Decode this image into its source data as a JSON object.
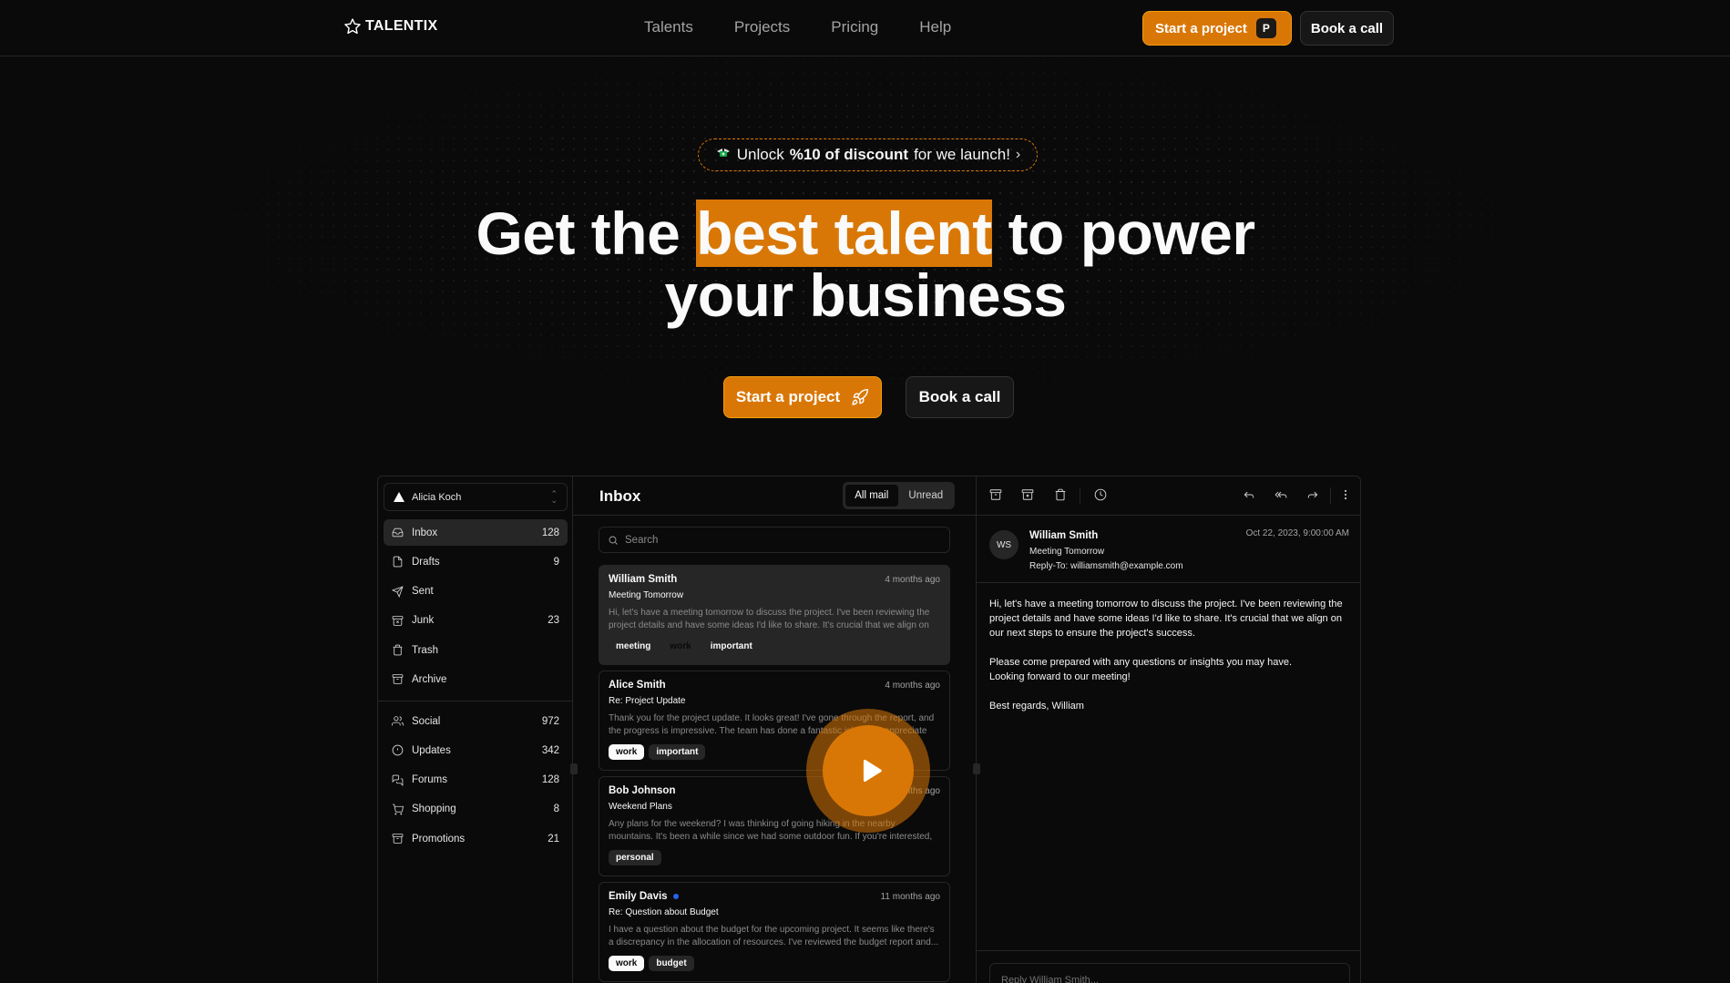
{
  "brand": {
    "name": "TALENTIX"
  },
  "nav": [
    "Talents",
    "Projects",
    "Pricing",
    "Help"
  ],
  "header": {
    "start_label": "Start a project",
    "start_kbd": "P",
    "book_label": "Book a call"
  },
  "hero": {
    "promo_prefix": "Unlock",
    "promo_bold": "%10 of discount",
    "promo_suffix": "for we launch!",
    "title_before": "Get the",
    "title_highlight": "best talent",
    "title_after": "to power",
    "title_line2": "your business",
    "cta_primary": "Start a project",
    "cta_secondary": "Book a call"
  },
  "colors": {
    "accent": "#d97706",
    "background": "#0a0a0a",
    "unread_dot": "#2563eb"
  },
  "mail_app": {
    "account": "Alicia Koch",
    "folders": [
      {
        "label": "Inbox",
        "count": "128",
        "icon": "inbox-icon"
      },
      {
        "label": "Drafts",
        "count": "9",
        "icon": "file-icon"
      },
      {
        "label": "Sent",
        "count": "",
        "icon": "send-icon"
      },
      {
        "label": "Junk",
        "count": "23",
        "icon": "archive-x-icon"
      },
      {
        "label": "Trash",
        "count": "",
        "icon": "trash-icon"
      },
      {
        "label": "Archive",
        "count": "",
        "icon": "archive-icon"
      }
    ],
    "categories": [
      {
        "label": "Social",
        "count": "972",
        "icon": "users-icon"
      },
      {
        "label": "Updates",
        "count": "342",
        "icon": "alert-circle-icon"
      },
      {
        "label": "Forums",
        "count": "128",
        "icon": "message-square-icon"
      },
      {
        "label": "Shopping",
        "count": "8",
        "icon": "shopping-cart-icon"
      },
      {
        "label": "Promotions",
        "count": "21",
        "icon": "archive-icon"
      }
    ],
    "list_title": "Inbox",
    "filter_all": "All mail",
    "filter_unread": "Unread",
    "search_placeholder": "Search",
    "mails": [
      {
        "from": "William Smith",
        "when": "4 months ago",
        "subject": "Meeting Tomorrow",
        "preview": "Hi, let's have a meeting tomorrow to discuss the project. I've been reviewing the project details and have some ideas I'd like to share. It's crucial that we align on our next step...",
        "tags": [
          "meeting",
          "work",
          "important"
        ]
      },
      {
        "from": "Alice Smith",
        "when": "4 months ago",
        "subject": "Re: Project Update",
        "preview": "Thank you for the project update. It looks great! I've gone through the report, and the progress is impressive. The team has done a fantastic job, and I appreciate the hard...",
        "tags": [
          "work",
          "important"
        ]
      },
      {
        "from": "Bob Johnson",
        "when": "5 months ago",
        "subject": "Weekend Plans",
        "preview": "Any plans for the weekend? I was thinking of going hiking in the nearby mountains. It's been a while since we had some outdoor fun. If you're interested, let me know, and we...",
        "tags": [
          "personal"
        ]
      },
      {
        "from": "Emily Davis",
        "when": "11 months ago",
        "subject": "Re: Question about Budget",
        "preview": "I have a question about the budget for the upcoming project. It seems like there's a discrepancy in the allocation of resources. I've reviewed the budget report and...",
        "tags": [
          "work",
          "budget"
        ]
      }
    ],
    "reader": {
      "initials": "WS",
      "from": "William Smith",
      "subject": "Meeting Tomorrow",
      "reply_to": "Reply-To: williamsmith@example.com",
      "date": "Oct 22, 2023, 9:00:00 AM",
      "body": [
        "Hi, let's have a meeting tomorrow to discuss the project. I've been reviewing the project details and have some ideas I'd like to share. It's crucial that we align on our next steps to ensure the project's success.",
        "Please come prepared with any questions or insights you may have.\nLooking forward to our meeting!",
        "Best regards, William"
      ],
      "reply_placeholder": "Reply William Smith..."
    }
  }
}
